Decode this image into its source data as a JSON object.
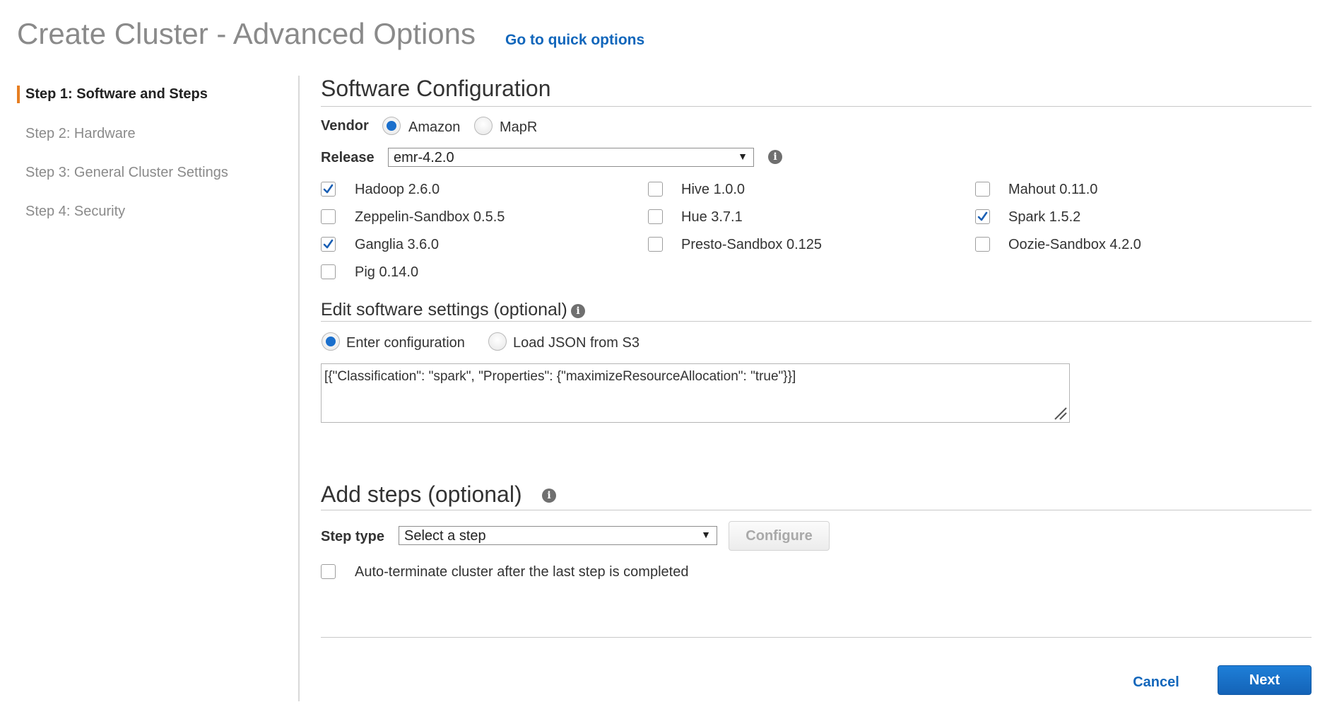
{
  "header": {
    "title": "Create Cluster - Advanced Options",
    "quick_link": "Go to quick options"
  },
  "nav": {
    "steps": [
      {
        "label": "Step 1: Software and Steps",
        "active": true
      },
      {
        "label": "Step 2: Hardware",
        "active": false
      },
      {
        "label": "Step 3: General Cluster Settings",
        "active": false
      },
      {
        "label": "Step 4: Security",
        "active": false
      }
    ]
  },
  "software": {
    "title": "Software Configuration",
    "vendor_label": "Vendor",
    "vendor_options": [
      "Amazon",
      "MapR"
    ],
    "vendor_selected": "Amazon",
    "release_label": "Release",
    "release_value": "emr-4.2.0",
    "applications": [
      {
        "label": "Hadoop 2.6.0",
        "checked": true
      },
      {
        "label": "Zeppelin-Sandbox 0.5.5",
        "checked": false
      },
      {
        "label": "Ganglia 3.6.0",
        "checked": true
      },
      {
        "label": "Pig 0.14.0",
        "checked": false
      },
      {
        "label": "Hive 1.0.0",
        "checked": false
      },
      {
        "label": "Hue 3.7.1",
        "checked": false
      },
      {
        "label": "Presto-Sandbox 0.125",
        "checked": false
      },
      {
        "label": "Mahout 0.11.0",
        "checked": false
      },
      {
        "label": "Spark 1.5.2",
        "checked": true
      },
      {
        "label": "Oozie-Sandbox 4.2.0",
        "checked": false
      }
    ]
  },
  "settings": {
    "title": "Edit software settings (optional)",
    "options": [
      "Enter configuration",
      "Load JSON from S3"
    ],
    "selected": "Enter configuration",
    "config_text": "[{\"Classification\": \"spark\", \"Properties\": {\"maximizeResourceAllocation\": \"true\"}}]"
  },
  "steps": {
    "title": "Add steps (optional)",
    "step_type_label": "Step type",
    "step_type_value": "Select a step",
    "configure_label": "Configure",
    "auto_terminate_label": "Auto-terminate cluster after the last step is completed",
    "auto_terminate_checked": false
  },
  "footer": {
    "cancel_label": "Cancel",
    "next_label": "Next"
  },
  "colors": {
    "accent": "#1166bb",
    "nav_active_bar": "#e67e22",
    "primary_button": "#1a6fcc"
  }
}
